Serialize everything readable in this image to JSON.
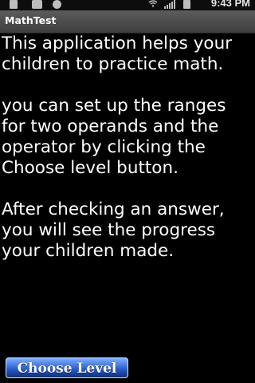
{
  "status_bar": {
    "time": "9:43 PM",
    "icons": [
      "usb-icon",
      "camera-icon",
      "check-icon",
      "wifi-icon",
      "signal-icon",
      "battery-icon"
    ]
  },
  "app": {
    "title": "MathTest"
  },
  "content": {
    "paragraphs": [
      "This application helps your children to practice math.",
      "you can set up the ranges for two operands and the operator by clicking the Choose level button.",
      "After checking an answer, you will see the progress your children made."
    ]
  },
  "actions": {
    "choose_level_label": "Choose Level"
  },
  "colors": {
    "background": "#000000",
    "title_bar": "#4d4d4d",
    "button": "#2457c8",
    "text": "#ffffff"
  }
}
